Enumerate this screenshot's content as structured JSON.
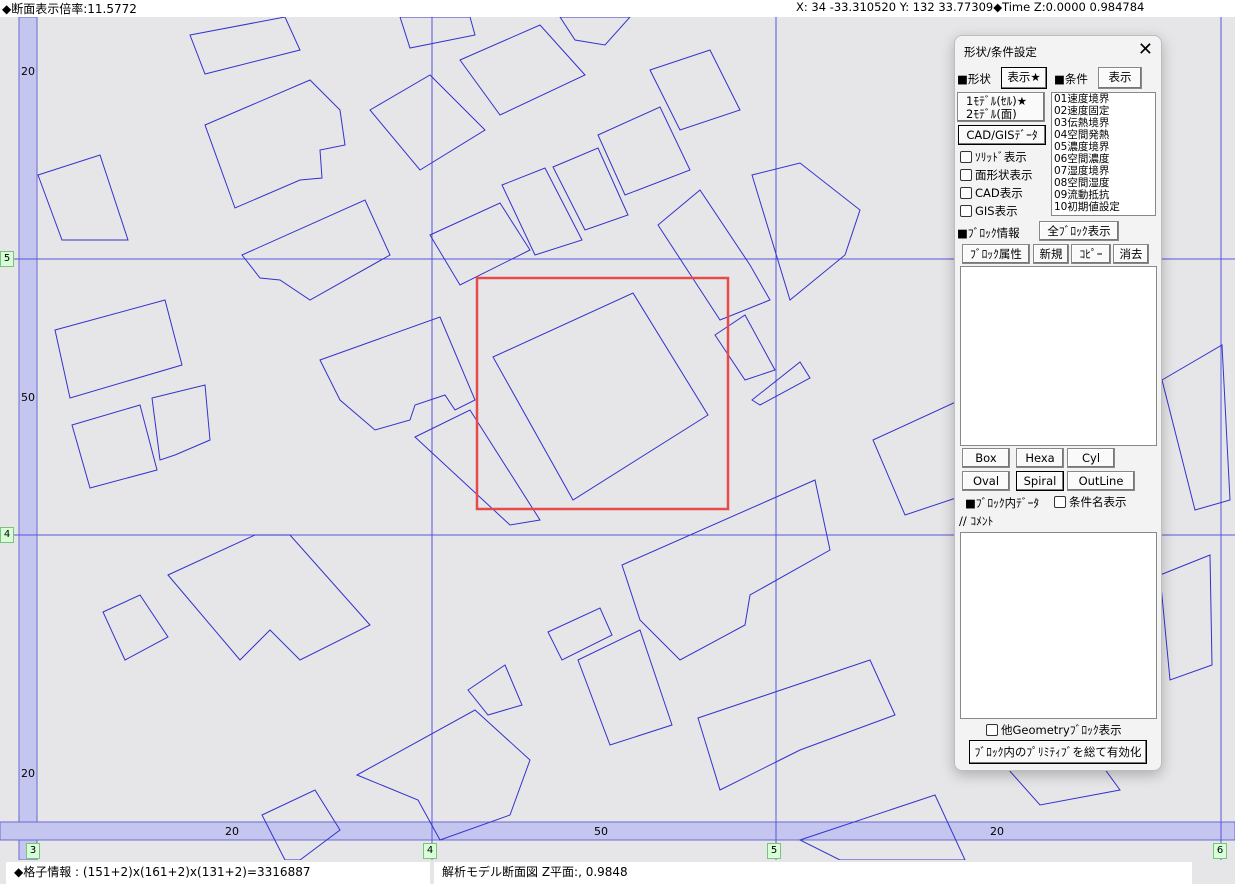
{
  "status_top": {
    "zoom_label": "◆断面表示倍率:11.5772",
    "coords": "X:     34  -33.310520      Y:     132  33.77309◆Time Z:0.0000  0.984784"
  },
  "axis": {
    "left_labels": [
      "20",
      "50",
      "20"
    ],
    "bottom_labels": [
      "20",
      "50",
      "20"
    ],
    "left_tags": [
      "5",
      "4"
    ],
    "bottom_tags": [
      "3",
      "4",
      "5",
      "6"
    ]
  },
  "status_bottom": {
    "grid_info": "◆格子情報 : (151+2)x(161+2)x(131+2)=3316887",
    "section_info": "解析モデル断面図 Z平面:, 0.9848"
  },
  "panel": {
    "title": "形状/条件設定",
    "close": "✕",
    "shape_label": "■形状",
    "show_star_btn": "表示★",
    "cond_label": "■条件",
    "show_btn": "表示",
    "model_btn_line1": "1ﾓﾃﾞﾙ(ｾﾙ)★",
    "model_btn_line2": "2ﾓﾃﾞﾙ(面)",
    "cad_gis_btn": "CAD/GISﾃﾞｰﾀ",
    "checks": [
      "ｿﾘｯﾄﾞ表示",
      "面形状表示",
      "CAD表示",
      "GIS表示"
    ],
    "conditions": [
      "01速度境界",
      "02速度固定",
      "03伝熱境界",
      "04空間発熱",
      "05濃度境界",
      "06空間濃度",
      "07湿度境界",
      "08空間湿度",
      "09流動抵抗",
      "10初期値設定"
    ],
    "block_info_label": "■ﾌﾞﾛｯｸ情報",
    "all_block_btn": "全ﾌﾞﾛｯｸ表示",
    "block_attr_btn": "ﾌﾞﾛｯｸ属性",
    "new_btn": "新規",
    "copy_btn": "ｺﾋﾟｰ",
    "delete_btn": "消去",
    "prim_btns": [
      "Box",
      "Hexa",
      "Cyl",
      "Oval",
      "Spiral",
      "OutLine"
    ],
    "block_data_label": "■ﾌﾞﾛｯｸ内ﾃﾞｰﾀ",
    "cond_name_check": "条件名表示",
    "comment_label": "// ｺﾒﾝﾄ",
    "other_geom_check": "他Geometryﾌﾞﾛｯｸ表示",
    "enable_all_btn": "ﾌﾞﾛｯｸ内のﾌﾟﾘﾐﾃｨﾌﾞを総て有効化"
  },
  "colors": {
    "canvas_bg": "#e6e6e9",
    "outline": "#3333cc",
    "axis_band": "#c4c6f0",
    "grid_line": "#5555dd",
    "selection": "#e84a4a"
  }
}
